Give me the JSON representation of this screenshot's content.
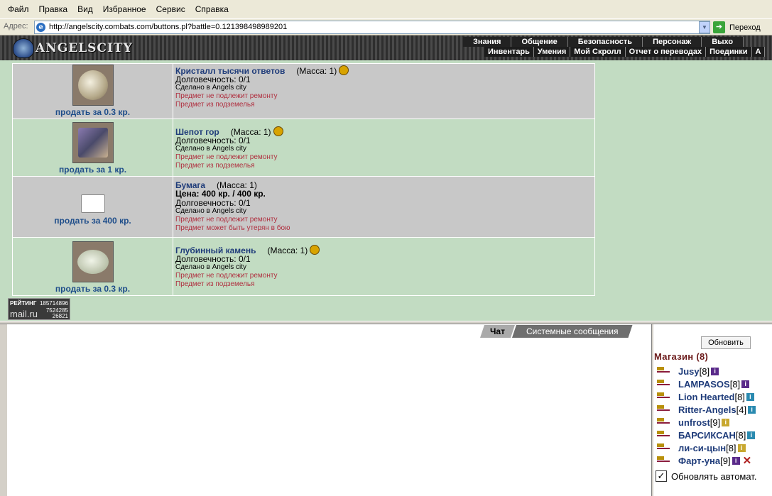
{
  "browser": {
    "menu": [
      "Файл",
      "Правка",
      "Вид",
      "Избранное",
      "Сервис",
      "Справка"
    ],
    "address_label": "Адрес:",
    "url": "http://angelscity.combats.com/buttons.pl?battle=0.121398498989201",
    "go_label": "Переход"
  },
  "game": {
    "logo": "ANGELSCITY",
    "top_menu": [
      "Знания",
      "Общение",
      "Безопасность",
      "Персонаж",
      "Выхо"
    ],
    "sub_menu": [
      "Инвентарь",
      "Умения",
      "Мой Скролл",
      "Отчет о переводах",
      "Поединки",
      "А"
    ]
  },
  "items": [
    {
      "sell": "продать за 0.3 кр.",
      "name": "Кристалл тысячи ответов",
      "mass": "(Масса: 1)",
      "durability": "Долговечность: 0/1",
      "made": "Сделано в Angels city",
      "note1": "Предмет не подлежит ремонту",
      "note2": "Предмет из подземелья",
      "icon": "crystal-icon",
      "color": "#d9d1b6"
    },
    {
      "sell": "продать за 1 кр.",
      "name": "Шепот гор",
      "mass": "(Масса: 1)",
      "durability": "Долговечность: 0/1",
      "made": "Сделано в Angels city",
      "note1": "Предмет не подлежит ремонту",
      "note2": "Предмет из подземелья",
      "icon": "mountain-scroll-icon",
      "color": "#6a6a8a"
    },
    {
      "sell": "продать за 400 кр.",
      "name": "Бумага",
      "mass": "(Масса: 1)",
      "price": "Цена: 400 кр. / 400 кр.",
      "durability": "Долговечность: 0/1",
      "made": "Сделано в Angels city",
      "note1": "Предмет не подлежит ремонту",
      "note2": "Предмет может быть утерян в бою",
      "icon": "paper-icon",
      "color": "#ffffff"
    },
    {
      "sell": "продать за 0.3 кр.",
      "name": "Глубинный камень",
      "mass": "(Масса: 1)",
      "durability": "Долговечность: 0/1",
      "made": "Сделано в Angels city",
      "note1": "Предмет не подлежит ремонту",
      "note2": "Предмет из подземелья",
      "icon": "stone-icon",
      "color": "#cfd8c8"
    }
  ],
  "rating": {
    "label": "РЕЙТИНГ",
    "brand": "mail.ru",
    "n1": "185714896",
    "n2": "7524285",
    "n3": "26821"
  },
  "chat": {
    "tab_chat": "Чат",
    "tab_system": "Системные сообщения"
  },
  "panel": {
    "refresh": "Обновить",
    "title": "Магазин (8)",
    "users": [
      {
        "name": "Jusy",
        "level": "[8]",
        "info": "purple"
      },
      {
        "name": "LAMPASOS",
        "level": "[8]",
        "info": "purple"
      },
      {
        "name": "Lion Hearted",
        "level": "[8]",
        "info": "blue"
      },
      {
        "name": "Ritter-Angels",
        "level": "[4]",
        "info": "blue"
      },
      {
        "name": "unfrost",
        "level": "[9]",
        "info": "yellow"
      },
      {
        "name": "БАРСИКСАН",
        "level": "[8]",
        "info": "blue"
      },
      {
        "name": "ли-си-цын",
        "level": "[8]",
        "info": "yellow"
      },
      {
        "name": "Фарт-уна",
        "level": "[9]",
        "info": "purple",
        "cross": true
      }
    ],
    "auto_refresh": "Обновлять автомат."
  }
}
